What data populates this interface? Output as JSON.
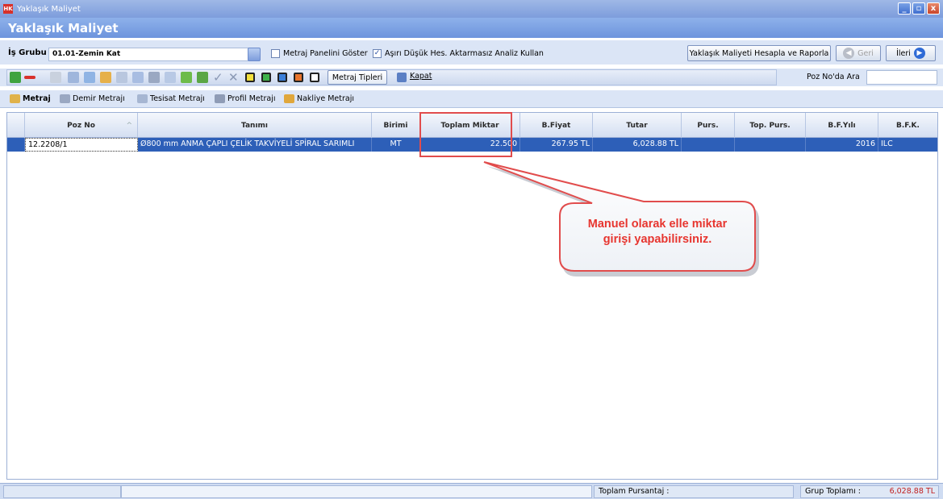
{
  "window": {
    "title": "Yaklaşık Maliyet",
    "app_icon_text": "HK",
    "minimize": "_",
    "maximize": "▫",
    "close": "x"
  },
  "header": {
    "title": "Yaklaşık Maliyet"
  },
  "group_row": {
    "label": "İş Grubu",
    "value": "01.01-Zemin Kat",
    "metraj_panel_label": "Metraj Panelini Göster",
    "metraj_panel_checked": false,
    "asiri_label": "Aşırı Düşük Hes. Aktarmasız Analiz Kullan",
    "asiri_checked": true,
    "calc_button": "Yaklaşık Maliyeti Hesapla ve Raporla",
    "back_button": "Geri",
    "next_button": "İleri"
  },
  "toolbar": {
    "metraj_tipleri": "Metraj Tipleri",
    "kapat": "Kapat",
    "poz_ara_label": "Poz No'da Ara",
    "poz_ara_value": ""
  },
  "tabs": [
    {
      "label": "Metraj",
      "icon": "chart-icon"
    },
    {
      "label": "Demir Metrajı",
      "icon": "rebar-icon"
    },
    {
      "label": "Tesisat Metrajı",
      "icon": "pipe-icon"
    },
    {
      "label": "Profil Metrajı",
      "icon": "profile-icon"
    },
    {
      "label": "Nakliye Metrajı",
      "icon": "truck-icon"
    }
  ],
  "grid": {
    "columns": [
      "Poz No",
      "Tanımı",
      "Birimi",
      "Toplam Miktar",
      "B.Fiyat",
      "Tutar",
      "Purs.",
      "Top. Purs.",
      "B.F.Yılı",
      "B.F.K."
    ],
    "rows": [
      {
        "poz_no": "12.2208/1",
        "tanimi": "Ø800 mm ANMA ÇAPLI ÇELİK TAKVİYELİ SPİRAL SARIMLI",
        "birimi": "MT",
        "toplam_miktar": "22.500",
        "b_fiyat": "267.95 TL",
        "tutar": "6,028.88 TL",
        "purs": "",
        "top_purs": "",
        "bf_yili": "2016",
        "bfk": "ILC"
      }
    ]
  },
  "callout": {
    "line1": "Manuel olarak elle miktar",
    "line2": "girişi yapabilirsiniz.",
    "color": "#e7352f"
  },
  "status": {
    "toplam_pursantaj_label": "Toplam Pursantaj :",
    "toplam_pursantaj_value": "",
    "grup_toplami_label": "Grup Toplamı :",
    "grup_toplami_value": "6,028.88 TL"
  },
  "colors": {
    "title_blue": "#7d9ddc",
    "selection_blue": "#2d5fb8",
    "panel_bg": "#dbe5f6",
    "highlight_red": "#e14c4c"
  }
}
